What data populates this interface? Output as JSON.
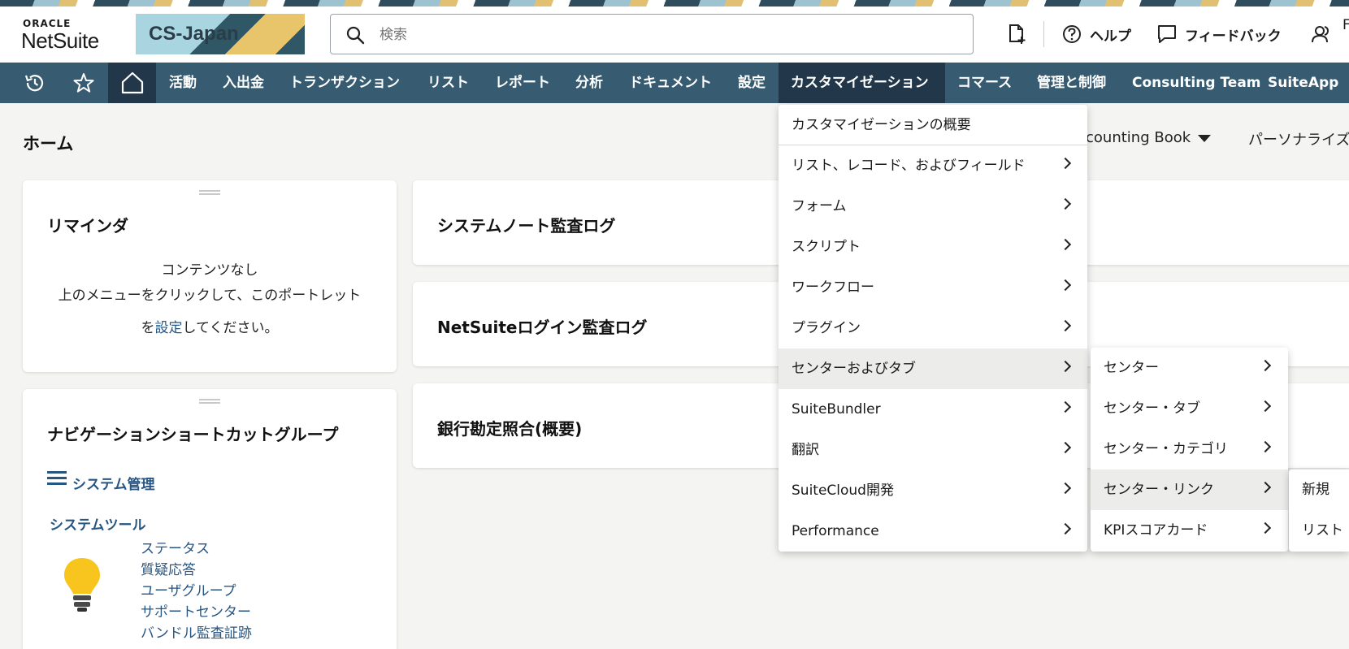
{
  "brand": {
    "oracle": "ORACLE",
    "netsuite": "NetSuite",
    "company": "CS-Japan"
  },
  "search": {
    "placeholder": "検索"
  },
  "header_actions": {
    "help": "ヘルプ",
    "feedback": "フィードバック",
    "user_initial": "F"
  },
  "nav": {
    "items": [
      "活動",
      "入出金",
      "トランザクション",
      "リスト",
      "レポート",
      "分析",
      "ドキュメント",
      "設定",
      "カスタマイゼーション",
      "コマース",
      "管理と制御",
      "Consulting Team",
      "SuiteApp"
    ]
  },
  "page": {
    "title": "ホーム",
    "accounting_book": "counting Book",
    "personalize": "パーソナライズ"
  },
  "reminders": {
    "title": "リマインダ",
    "empty": "コンテンツなし",
    "line1": "上のメニューをクリックして、このポートレット",
    "line2_prefix": "を",
    "line2_link": "設定",
    "line2_suffix": "してください。"
  },
  "portlets": {
    "system_notes": "システムノート監査ログ",
    "login_audit": "NetSuiteログイン監査ログ",
    "bank_recon": "銀行勘定照合(概要)"
  },
  "shortcuts": {
    "title": "ナビゲーションショートカットグループ",
    "group": "システム管理",
    "tools": "システムツール",
    "links": [
      "ステータス",
      "質疑応答",
      "ユーザグループ",
      "サポートセンター",
      "バンドル監査証跡"
    ]
  },
  "menu_customization": {
    "overview": "カスタマイゼーションの概要",
    "items": [
      "リスト、レコード、およびフィールド",
      "フォーム",
      "スクリプト",
      "ワークフロー",
      "プラグイン",
      "センターおよびタブ",
      "SuiteBundler",
      "翻訳",
      "SuiteCloud開発",
      "Performance"
    ]
  },
  "menu_centers": {
    "items": [
      "センター",
      "センター・タブ",
      "センター・カテゴリ",
      "センター・リンク",
      "KPIスコアカード"
    ]
  },
  "menu_links": {
    "items": [
      "新規",
      "リスト"
    ]
  },
  "colors": {
    "nav_bg": "#375c71",
    "nav_active": "#22384a",
    "link": "#285683",
    "bulb": "#f7c51e"
  }
}
